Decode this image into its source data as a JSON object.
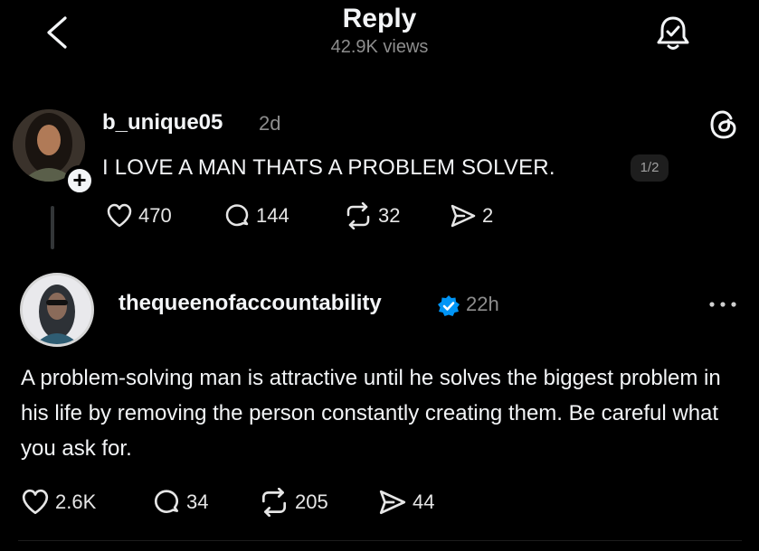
{
  "header": {
    "title": "Reply",
    "views": "42.9K views"
  },
  "parent_post": {
    "username": "b_unique05",
    "time": "2d",
    "text": "I LOVE A MAN THATS A PROBLEM SOLVER.",
    "page_indicator": "1/2",
    "follow_symbol": "+",
    "likes": "470",
    "comments": "144",
    "reposts": "32",
    "shares": "2"
  },
  "reply_post": {
    "username": "thequeenofaccountability",
    "time": "22h",
    "text": "A problem-solving man is attractive until he solves the biggest problem in his life by removing the person constantly creating them. Be careful what you ask for.",
    "likes": "2.6K",
    "comments": "34",
    "reposts": "205",
    "shares": "44"
  },
  "colors": {
    "background": "#000000",
    "text_primary": "#f3f5f7",
    "text_secondary": "#8d8d8d",
    "verified_blue": "#0095f6"
  },
  "icons": [
    "chevron-left-icon",
    "bell-icon",
    "threads-logo-icon",
    "heart-icon",
    "comment-icon",
    "repost-icon",
    "share-icon",
    "verified-icon",
    "more-icon"
  ]
}
